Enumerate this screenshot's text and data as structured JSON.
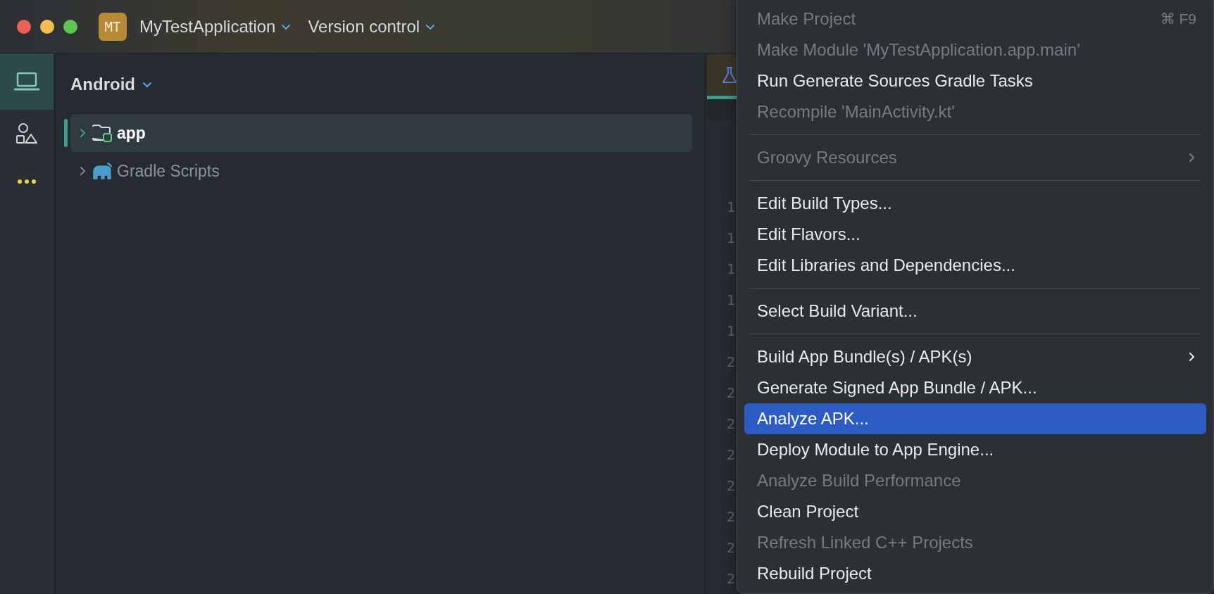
{
  "titlebar": {
    "badge": "MT",
    "project": "MyTestApplication",
    "vcs": "Version control"
  },
  "toolstrip": [
    {
      "kind": "monitor",
      "selected": true
    },
    {
      "kind": "shapes",
      "selected": false
    },
    {
      "kind": "more",
      "selected": false
    }
  ],
  "project_panel": {
    "view": "Android",
    "tree": [
      {
        "label": "app",
        "kind": "module",
        "selected": true,
        "expanded": false
      },
      {
        "label": "Gradle Scripts",
        "kind": "gradle",
        "selected": false,
        "expanded": false
      }
    ]
  },
  "editor": {
    "line_numbers": [
      "1",
      "1",
      "1",
      "1",
      "1",
      "2",
      "2",
      "2",
      "2",
      "2",
      "2",
      "2",
      "2"
    ]
  },
  "menu": [
    {
      "kind": "item",
      "label": "Make Project",
      "disabled": true,
      "selected": false,
      "shortcut": "⌘ F9"
    },
    {
      "kind": "item",
      "label": "Make Module 'MyTestApplication.app.main'",
      "disabled": true,
      "selected": false
    },
    {
      "kind": "item",
      "label": "Run Generate Sources Gradle Tasks",
      "disabled": false,
      "selected": false
    },
    {
      "kind": "item",
      "label": "Recompile 'MainActivity.kt'",
      "disabled": true,
      "selected": false
    },
    {
      "kind": "separator"
    },
    {
      "kind": "item",
      "label": "Groovy Resources",
      "disabled": true,
      "selected": false,
      "submenu": true
    },
    {
      "kind": "separator"
    },
    {
      "kind": "item",
      "label": "Edit Build Types...",
      "disabled": false,
      "selected": false
    },
    {
      "kind": "item",
      "label": "Edit Flavors...",
      "disabled": false,
      "selected": false
    },
    {
      "kind": "item",
      "label": "Edit Libraries and Dependencies...",
      "disabled": false,
      "selected": false
    },
    {
      "kind": "separator"
    },
    {
      "kind": "item",
      "label": "Select Build Variant...",
      "disabled": false,
      "selected": false
    },
    {
      "kind": "separator"
    },
    {
      "kind": "item",
      "label": "Build App Bundle(s) / APK(s)",
      "disabled": false,
      "selected": false,
      "submenu": true
    },
    {
      "kind": "item",
      "label": "Generate Signed App Bundle / APK...",
      "disabled": false,
      "selected": false
    },
    {
      "kind": "item",
      "label": "Analyze APK...",
      "disabled": false,
      "selected": true
    },
    {
      "kind": "item",
      "label": "Deploy Module to App Engine...",
      "disabled": false,
      "selected": false
    },
    {
      "kind": "item",
      "label": "Analyze Build Performance",
      "disabled": true,
      "selected": false
    },
    {
      "kind": "item",
      "label": "Clean Project",
      "disabled": false,
      "selected": false
    },
    {
      "kind": "item",
      "label": "Refresh Linked C++ Projects",
      "disabled": true,
      "selected": false
    },
    {
      "kind": "item",
      "label": "Rebuild Project",
      "disabled": false,
      "selected": false
    }
  ]
}
